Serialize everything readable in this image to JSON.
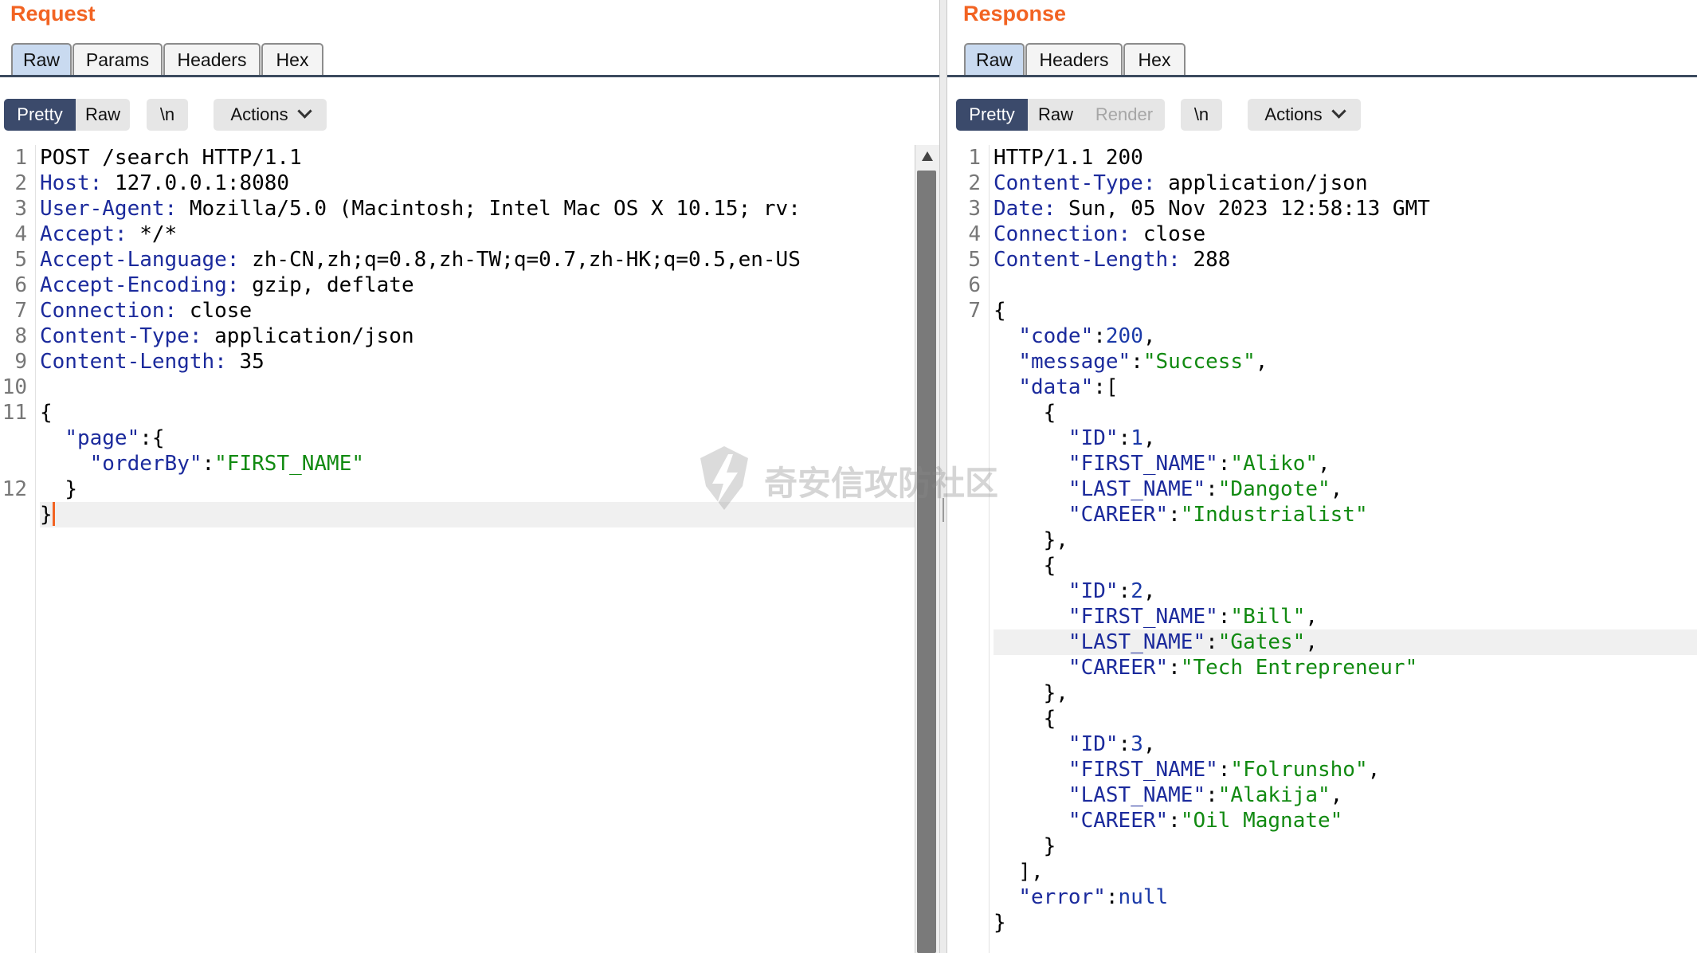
{
  "request": {
    "title": "Request",
    "tabs": [
      "Raw",
      "Params",
      "Headers",
      "Hex"
    ],
    "active_tab": "Raw",
    "view_modes": [
      "Pretty",
      "Raw"
    ],
    "active_view": "Pretty",
    "newline_label": "\\n",
    "actions_label": "Actions",
    "line_numbers": [
      "1",
      "2",
      "3",
      "4",
      "5",
      "6",
      "7",
      "8",
      "9",
      "10",
      "11",
      "12"
    ],
    "lines": [
      "POST /search HTTP/1.1",
      "127.0.0.1:8080",
      "Mozilla/5.0 (Macintosh; Intel Mac OS X 10.15; rv:",
      "*/*",
      "zh-CN,zh;q=0.8,zh-TW;q=0.7,zh-HK;q=0.5,en-US",
      "gzip, deflate",
      "close",
      "application/json",
      "35"
    ],
    "header_names": [
      "Host:",
      "User-Agent:",
      "Accept:",
      "Accept-Language:",
      "Accept-Encoding:",
      "Connection:",
      "Content-Type:",
      "Content-Length:"
    ],
    "body": {
      "open": "{",
      "page_key": "\"page\"",
      "page_open": ":{",
      "orderby_key": "\"orderBy\"",
      "colon": ":",
      "orderby_value": "\"FIRST_NAME\"",
      "inner_close": "}",
      "close": "}"
    }
  },
  "response": {
    "title": "Response",
    "tabs": [
      "Raw",
      "Headers",
      "Hex"
    ],
    "active_tab": "Raw",
    "view_modes": [
      "Pretty",
      "Raw",
      "Render"
    ],
    "active_view": "Pretty",
    "newline_label": "\\n",
    "actions_label": "Actions",
    "line_numbers": [
      "1",
      "2",
      "3",
      "4",
      "5",
      "6",
      "7"
    ],
    "status_line": "HTTP/1.1 200",
    "header_names": [
      "Content-Type:",
      "Date:",
      "Connection:",
      "Content-Length:"
    ],
    "header_values": [
      "application/json",
      "Sun, 05 Nov 2023 12:58:13 GMT",
      "close",
      "288"
    ],
    "json": {
      "code_key": "\"code\"",
      "code_value": "200",
      "message_key": "\"message\"",
      "message_value": "\"Success\"",
      "data_key": "\"data\"",
      "error_key": "\"error\"",
      "error_value": "null",
      "records": [
        {
          "id": "1",
          "first": "\"Aliko\"",
          "last": "\"Dangote\"",
          "career": "\"Industrialist\""
        },
        {
          "id": "2",
          "first": "\"Bill\"",
          "last": "\"Gates\"",
          "career": "\"Tech Entrepreneur\""
        },
        {
          "id": "3",
          "first": "\"Folrunsho\"",
          "last": "\"Alakija\"",
          "career": "\"Oil Magnate\""
        }
      ],
      "field_keys": {
        "id": "\"ID\"",
        "first": "\"FIRST_NAME\"",
        "last": "\"LAST_NAME\"",
        "career": "\"CAREER\""
      }
    }
  },
  "watermark": "奇安信攻防社区",
  "colors": {
    "accent": "#f26322",
    "key": "#1b2a9c",
    "string": "#118a11",
    "active_view": "#3b4a6b",
    "active_tab": "#c9daf0"
  }
}
